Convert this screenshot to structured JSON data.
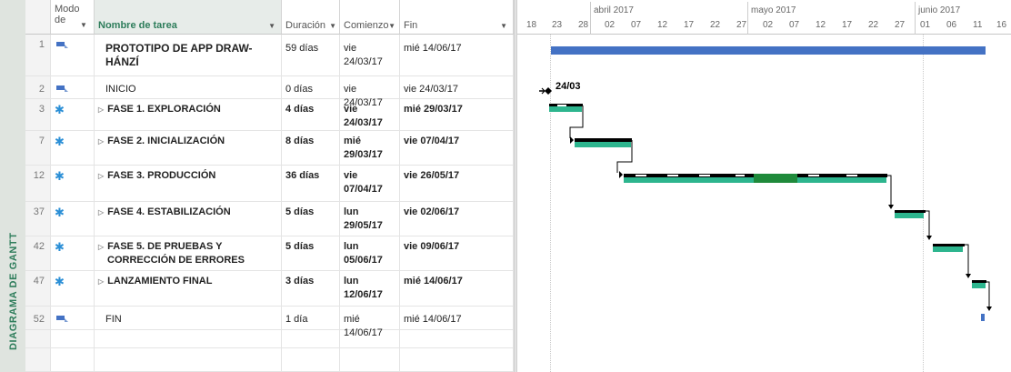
{
  "sidebar": {
    "label": "DIAGRAMA DE GANTT"
  },
  "columns": {
    "mode": "Modo de",
    "name": "Nombre de tarea",
    "duration": "Duración",
    "start": "Comienzo",
    "end": "Fin"
  },
  "tasks": [
    {
      "id": "1",
      "name": "PROTOTIPO DE APP DRAW-HÁNZÍ",
      "duration": "59 días",
      "start": "vie 24/03/17",
      "end": "mié 14/06/17"
    },
    {
      "id": "2",
      "name": "INICIO",
      "duration": "0 días",
      "start": "vie 24/03/17",
      "end": "vie 24/03/17"
    },
    {
      "id": "3",
      "name": "FASE 1. EXPLORACIÓN",
      "duration": "4 días",
      "start": "vie 24/03/17",
      "end": "mié 29/03/17"
    },
    {
      "id": "7",
      "name": "FASE 2. INICIALIZACIÓN",
      "duration": "8 días",
      "start": "mié 29/03/17",
      "end": "vie 07/04/17"
    },
    {
      "id": "12",
      "name": "FASE 3. PRODUCCIÓN",
      "duration": "36 días",
      "start": "vie 07/04/17",
      "end": "vie 26/05/17"
    },
    {
      "id": "37",
      "name": "FASE 4. ESTABILIZACIÓN",
      "duration": "5 días",
      "start": "lun 29/05/17",
      "end": "vie 02/06/17"
    },
    {
      "id": "42",
      "name": "FASE 5. DE PRUEBAS Y CORRECCIÓN DE ERRORES",
      "duration": "5 días",
      "start": "lun 05/06/17",
      "end": "vie 09/06/17"
    },
    {
      "id": "47",
      "name": "LANZAMIENTO FINAL",
      "duration": "3 días",
      "start": "lun 12/06/17",
      "end": "mié 14/06/17"
    },
    {
      "id": "52",
      "name": "FIN",
      "duration": "1 día",
      "start": "mié 14/06/17",
      "end": "mié 14/06/17"
    }
  ],
  "timescale": {
    "months": [
      "abril 2017",
      "mayo 2017",
      "junio 2017"
    ],
    "days": [
      "18",
      "23",
      "28",
      "02",
      "07",
      "12",
      "17",
      "22",
      "27",
      "02",
      "07",
      "12",
      "17",
      "22",
      "27",
      "01",
      "06",
      "11",
      "16"
    ]
  },
  "milestone_label": "24/03",
  "colors": {
    "summary": "#4472c4",
    "task": "#2db58e",
    "progress": "#1f8a3b",
    "accent": "#2e7d5b"
  }
}
